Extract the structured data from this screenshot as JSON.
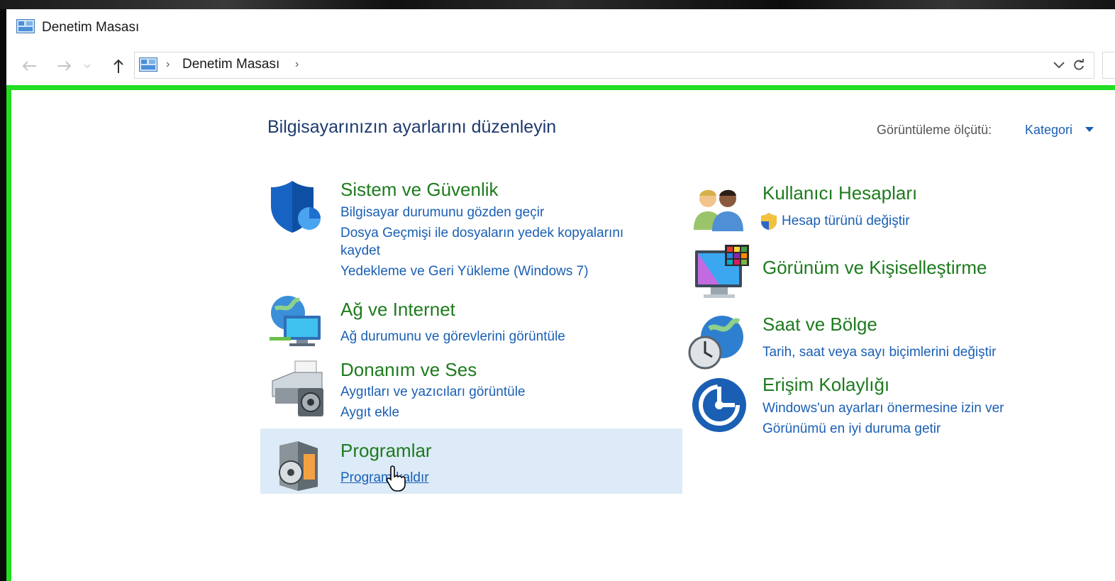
{
  "window": {
    "title": "Denetim Masası"
  },
  "address": {
    "path": [
      "Denetim Masası"
    ]
  },
  "main": {
    "heading": "Bilgisayarınızın ayarlarını düzenleyin",
    "view_by_label": "Görüntüleme ölçütü:",
    "view_by_value": "Kategori"
  },
  "categories": {
    "system_security": {
      "title": "Sistem ve Güvenlik",
      "links": [
        "Bilgisayar durumunu gözden geçir",
        "Dosya Geçmişi ile dosyaların yedek kopyalarını",
        "kaydet",
        "Yedekleme ve Geri Yükleme (Windows 7)"
      ]
    },
    "network": {
      "title": "Ağ ve Internet",
      "links": [
        "Ağ durumunu ve görevlerini görüntüle"
      ]
    },
    "hardware": {
      "title": "Donanım ve Ses",
      "links": [
        "Aygıtları ve yazıcıları görüntüle",
        "Aygıt ekle"
      ]
    },
    "programs": {
      "title": "Programlar",
      "links": [
        "Program kaldır"
      ]
    },
    "users": {
      "title": "Kullanıcı Hesapları",
      "links": [
        "Hesap türünü değiştir"
      ]
    },
    "appearance": {
      "title": "Görünüm ve Kişiselleştirme",
      "links": []
    },
    "clock": {
      "title": "Saat ve Bölge",
      "links": [
        "Tarih, saat veya sayı biçimlerini değiştir"
      ]
    },
    "ease": {
      "title": "Erişim Kolaylığı",
      "links": [
        "Windows'un ayarları önermesine izin ver",
        "Görünümü en iyi duruma getir"
      ]
    },
    "icons": [
      "shield-icon",
      "network-globe-icon",
      "printer-icon",
      "programs-box-icon",
      "users-icon",
      "monitor-palette-icon",
      "clock-globe-icon",
      "ease-of-access-icon",
      "uac-shield-icon"
    ]
  },
  "colors": {
    "title_green": "#1e7b1e",
    "link_blue": "#1a5fb4",
    "highlight": "#dcebf7",
    "frame_green": "#22dd22"
  }
}
